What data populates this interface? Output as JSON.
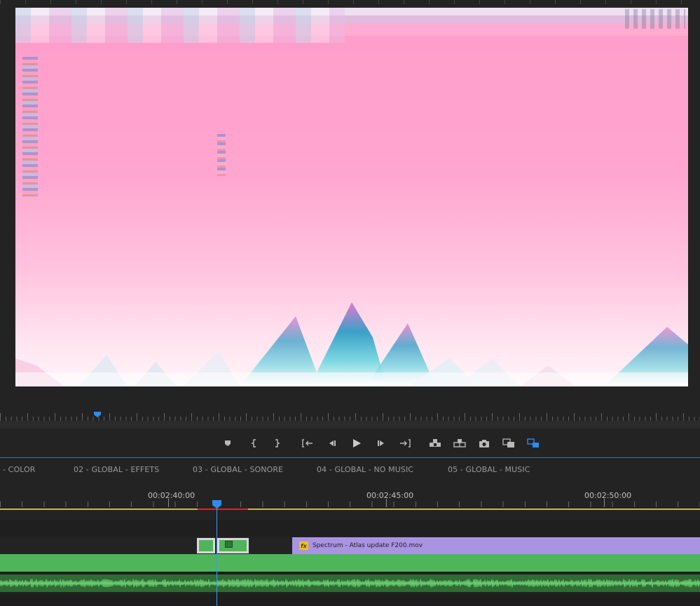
{
  "transport": {
    "buttons": [
      {
        "name": "add-marker-icon"
      },
      {
        "name": "mark-in-icon"
      },
      {
        "name": "mark-out-icon"
      },
      {
        "name": "go-to-in-icon"
      },
      {
        "name": "step-back-icon"
      },
      {
        "name": "play-icon"
      },
      {
        "name": "step-forward-icon"
      },
      {
        "name": "go-to-out-icon"
      },
      {
        "name": "lift-icon"
      },
      {
        "name": "extract-icon"
      },
      {
        "name": "export-frame-icon"
      },
      {
        "name": "comparison-view-icon"
      },
      {
        "name": "proxy-toggle-icon"
      }
    ]
  },
  "sequence_tabs": [
    {
      "label": "- COLOR"
    },
    {
      "label": "02 - GLOBAL  - EFFETS"
    },
    {
      "label": "03 - GLOBAL  - SONORE"
    },
    {
      "label": "04 - GLOBAL  - NO MUSIC"
    },
    {
      "label": "05 - GLOBAL  - MUSIC"
    }
  ],
  "ruler": {
    "timecodes": [
      "00:02:40:00",
      "00:02:45:00",
      "00:02:50:00"
    ]
  },
  "timeline": {
    "main_clip": {
      "label": "Spectrum - Atlas update F200.mov",
      "fx": "fx"
    },
    "colors": {
      "video_clip": "#a994e2",
      "audio_clip": "#4fb55a",
      "playhead": "#2d8ceb",
      "work_area": "#c8b84a",
      "render_bar": "#d12a2a"
    }
  }
}
